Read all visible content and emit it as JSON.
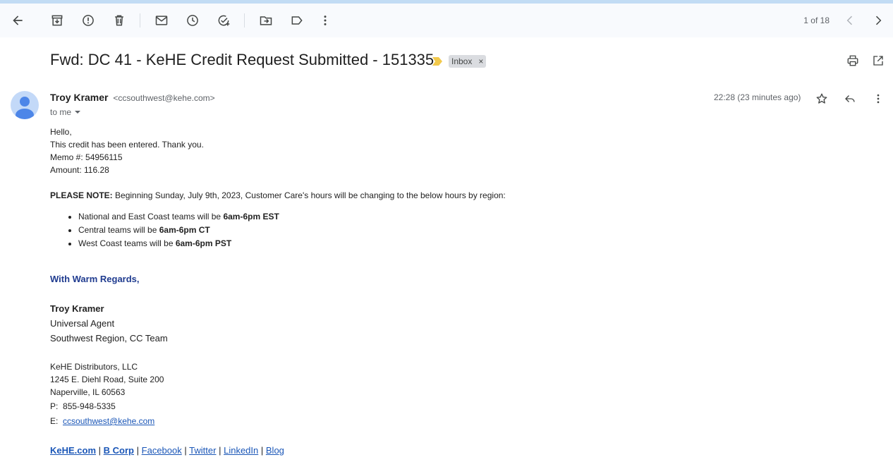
{
  "toolbar": {
    "buttons": [
      {
        "name": "back",
        "label": "Back"
      },
      {
        "name": "archive",
        "label": "Archive"
      },
      {
        "name": "report-spam",
        "label": "Report spam"
      },
      {
        "name": "delete",
        "label": "Delete"
      },
      {
        "name": "mark-unread",
        "label": "Mark as unread"
      },
      {
        "name": "snooze",
        "label": "Snooze"
      },
      {
        "name": "add-task",
        "label": "Add to Tasks"
      },
      {
        "name": "move-to",
        "label": "Move to"
      },
      {
        "name": "labels",
        "label": "Labels"
      },
      {
        "name": "more",
        "label": "More"
      }
    ],
    "pager_text": "1 of 18"
  },
  "message": {
    "subject": "Fwd: DC 41 - KeHE Credit Request Submitted - 151335",
    "label_chip": "Inbox",
    "label_chip_remove": "×",
    "sender_name": "Troy Kramer",
    "sender_email": "<ccsouthwest@kehe.com>",
    "to_text": "to me",
    "time_text": "22:28 (23 minutes ago)"
  },
  "body": {
    "greeting": "Hello,",
    "line1": "This credit has been entered. Thank you.",
    "memo": "Memo #: 54956115",
    "amount": "Amount: 116.28",
    "note_label": "PLEASE NOTE:",
    "note_text": " Beginning Sunday, July 9th, 2023, Customer Care's hours will be changing to the below hours by region:",
    "hours": [
      {
        "prefix": "National and East Coast teams will be ",
        "hours": "6am-6pm EST"
      },
      {
        "prefix": "Central teams will be ",
        "hours": "6am-6pm CT"
      },
      {
        "prefix": "West Coast teams will be ",
        "hours": "6am-6pm PST"
      }
    ]
  },
  "signature": {
    "regards": "With Warm Regards,",
    "name": "Troy Kramer",
    "title": "Universal Agent",
    "team": "Southwest Region, CC Team",
    "company": "KeHE Distributors, LLC",
    "address1": "1245 E. Diehl Road, Suite 200",
    "address2": "Naperville, IL 60563",
    "phone_label": "P:",
    "phone": "855-948-5335",
    "email_label": "E:",
    "email": "ccsouthwest@kehe.com",
    "links": [
      "KeHE.com",
      "B Corp",
      "Facebook",
      "Twitter",
      "LinkedIn",
      "Blog"
    ],
    "link_separator": "|"
  },
  "colors": {
    "toolbar_bg": "#f8fafd",
    "accent_blue": "#1f3b8f",
    "link_blue": "#1a56b7",
    "importance_yellow": "#f2c94c"
  }
}
